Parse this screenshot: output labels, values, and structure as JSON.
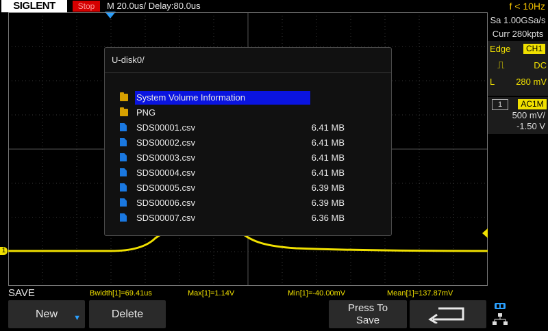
{
  "topbar": {
    "brand": "SIGLENT",
    "run_status": "Stop",
    "timebase": "M 20.0us/  Delay:80.0us",
    "frequency": "f < 10Hz"
  },
  "sidepanel": {
    "sample_rate": "Sa 1.00GSa/s",
    "memory": "Curr 280kpts",
    "trigger_type": "Edge",
    "trigger_source": "CH1",
    "trigger_coupling": "DC",
    "trigger_level_label": "L",
    "trigger_level": "280 mV",
    "channel_number": "1",
    "channel_coupling": "AC1M",
    "channel_scale": "500 mV/",
    "channel_offset": "-1.50 V"
  },
  "dialog": {
    "path": "U-disk0/",
    "entries": [
      {
        "name": "System Volume Information",
        "size": "",
        "type": "folder"
      },
      {
        "name": "PNG",
        "size": "",
        "type": "folder"
      },
      {
        "name": "SDS00001.csv",
        "size": "6.41 MB",
        "type": "file"
      },
      {
        "name": "SDS00002.csv",
        "size": "6.41 MB",
        "type": "file"
      },
      {
        "name": "SDS00003.csv",
        "size": "6.41 MB",
        "type": "file"
      },
      {
        "name": "SDS00004.csv",
        "size": "6.41 MB",
        "type": "file"
      },
      {
        "name": "SDS00005.csv",
        "size": "6.39 MB",
        "type": "file"
      },
      {
        "name": "SDS00006.csv",
        "size": "6.39 MB",
        "type": "file"
      },
      {
        "name": "SDS00007.csv",
        "size": "6.36 MB",
        "type": "file"
      }
    ]
  },
  "channel_marker": "1",
  "bottom": {
    "menu_title": "SAVE",
    "measurements": {
      "bwidth": "Bwidth[1]=69.41us",
      "max": "Max[1]=1.14V",
      "min": "Min[1]=-40.00mV",
      "mean": "Mean[1]=137.87mV"
    },
    "softkeys": {
      "new": "New",
      "delete": "Delete",
      "press_to": "Press To",
      "save": "Save"
    }
  },
  "colors": {
    "channel1": "#f0e000",
    "selection": "#0a14e0",
    "run_stop": "#d40000",
    "accent_blue": "#2aa0ff"
  }
}
